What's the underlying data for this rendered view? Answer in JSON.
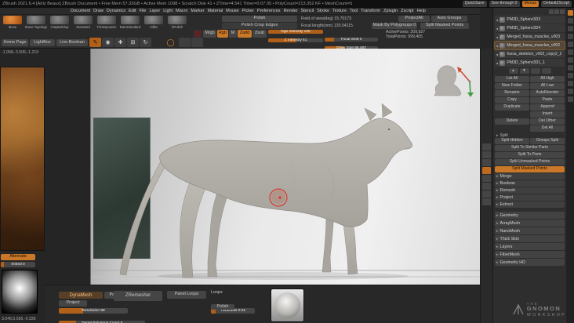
{
  "title_bar": {
    "title": "ZBrush 2021.6.4 [Artiz Beaux]   ZBrush Document • Free Mem 57.33GB • Active Mem 1098 • Scratch Disk 41 • ZTime=4.541 Timer=0:07:35 • PolyCount=213.352 KF • MeshCount=5",
    "quicksave": "QuickSave",
    "see_through": "See-through 0",
    "menus": "Menus",
    "default_zscript": "DefaultZScript"
  },
  "menu_bar": [
    "Document",
    "Draw",
    "Dynamics",
    "Edit",
    "File",
    "Layer",
    "Light",
    "Macro",
    "Marker",
    "Material",
    "Mouse",
    "Picker",
    "Preferences",
    "Render",
    "Stencil",
    "Stroke",
    "Texture",
    "Tool",
    "Transform",
    "Zplugin",
    "Zscript",
    "Help"
  ],
  "brushes": [
    {
      "label": "Move"
    },
    {
      "label": "Move Topological"
    },
    {
      "label": "ClayBuildup"
    },
    {
      "label": "Standard"
    },
    {
      "label": "TrimDynamic"
    },
    {
      "label": "DamStandard"
    },
    {
      "label": "Inflat"
    },
    {
      "label": "hPolish"
    }
  ],
  "toolbar": {
    "polish": "Polish",
    "polish_crisp": "Polish Crisp Edges",
    "field_of_view": "Field of view(deg) 15.70173",
    "focal_length": "Focal length(mm) 130.54115",
    "mask_by_polygroups": "Mask By Polygroups 0",
    "project_all": "ProjectAll",
    "auto_groups": "Auto Groups",
    "split_masked_points": "Split Masked Points",
    "mrgb": "Mrgb",
    "rgb": "Rgb",
    "m": "M",
    "zadd": "Zadd",
    "zsub": "Zsub",
    "rgb_intensity": "Rgb Intensity 100",
    "z_intensity": "Z Intensity 51",
    "focal_shift": "Focal Shift 0",
    "draw_size": "Draw Size 56.467",
    "active_points": "ActivePoints: 209,927",
    "total_points": "TotalPoints: 999,405"
  },
  "nav": {
    "home_page": "Home Page",
    "lightbox": "LightBox",
    "live_boolean": "Live Boolean"
  },
  "icons": {
    "edit": "✎",
    "draw": "◉",
    "move": "✚",
    "scale": "⊞",
    "rotate": "↻",
    "ring": "◯",
    "section_arrow": "▸",
    "up": "▲",
    "down": "▼",
    "eye": "●"
  },
  "left_tray": {
    "coords_top": "-1.068,-3.506,-1.219",
    "alternate": "Alternate",
    "imbed": "Imbed 0",
    "coords_bottom": "3.046,5.556,-0.339"
  },
  "bottom_panel": {
    "dynamesh": "DynaMesh",
    "polish": "Polish",
    "project": "Project",
    "resolution": "Resolution 88",
    "target_polygons": "Target Polygons Count 5",
    "zremesher": "ZRemesher",
    "panel_loops": "Panel Loops",
    "loops": "Loops",
    "thickness": "Thickness 0.01",
    "polish2": "Polish"
  },
  "subtool_panel": {
    "subtools": [
      {
        "name": "PM3D_Sphere3D3"
      },
      {
        "name": "PM3D_Sphere3D4"
      },
      {
        "name": "Merged_fossa_muscles_v003"
      },
      {
        "name": "Merged_fossa_muscles_v002"
      },
      {
        "name": "fossa_skeleton_v002_copy2_2"
      },
      {
        "name": "PM3D_Sphere3D1_1"
      }
    ],
    "button_rows": [
      [
        "List All",
        "All High"
      ],
      [
        "New Folder",
        "All Low"
      ],
      [
        "Rename",
        "AutoReorder"
      ],
      [
        "Copy",
        "Paste"
      ],
      [
        "Duplicate",
        "Append"
      ],
      [
        "",
        "Insert"
      ],
      [
        "Delete",
        "Del Other"
      ],
      [
        "",
        "Del All"
      ]
    ],
    "split_header": "Split",
    "split_pair": [
      "Split Hidden",
      "Groups Split"
    ],
    "split_buttons": [
      "Split To Similar Parts",
      "Split To Parts",
      "Split Unmasked Points",
      "Split Masked Points"
    ],
    "sections": [
      "Merge",
      "Boolean",
      "Remesh",
      "Project",
      "Extract"
    ],
    "palette_sections": [
      "Geometry",
      "ArrayMesh",
      "NanoMesh",
      "Thick Skin",
      "Layers",
      "FiberMesh",
      "Geometry HD"
    ]
  },
  "watermark": {
    "the": "THE",
    "gnomon": "GNOMON",
    "workshop": "WORKSHOP"
  },
  "colors": {
    "accent": "#e8862a",
    "canvas_bg": "#e9e9e9",
    "cursor_red": "#e0281e"
  }
}
